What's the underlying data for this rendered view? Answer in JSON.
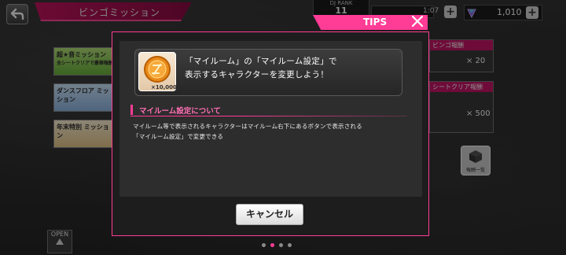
{
  "header": {
    "title": "ビンゴミッション",
    "dj_rank_label": "DJ RANK",
    "dj_rank_value": "11",
    "stamina_text": "1:07",
    "gem_count": "1,010",
    "back_icon": "back-arrow-icon",
    "gem_icon": "gem-icon"
  },
  "background": {
    "left_banners": [
      "超★音ミッション",
      "全シートクリアで豪華報酬",
      "ダンスフロア ミッション",
      "年末特別 ミッション"
    ],
    "right_cards": [
      {
        "title": "ビンゴ報酬",
        "reward": "× 20"
      },
      {
        "title": "シートクリア報酬",
        "reward": "× 500"
      }
    ],
    "reward_list_label": "報酬一覧",
    "open_label": "OPEN"
  },
  "dialog": {
    "tab_label": "TIPS",
    "close_icon": "close-icon",
    "item_count": "×10,000",
    "message_lines": [
      "「マイルーム」の「マイルーム設定」で",
      "表示するキャラクターを変更しよう！"
    ],
    "section_title": "マイルーム設定について",
    "body_lines": [
      "マイルーム等で表示されるキャラクターはマイルーム右下にあるボタンで表示される",
      "「マイルーム設定」で変更できる"
    ],
    "cancel_label": "キャンセル"
  },
  "pagination": {
    "count": 4,
    "active_index": 1
  },
  "colors": {
    "accent": "#ff3c96",
    "dialog_bg": "#1d1d1d",
    "panel_bg": "#2d2d2d"
  }
}
